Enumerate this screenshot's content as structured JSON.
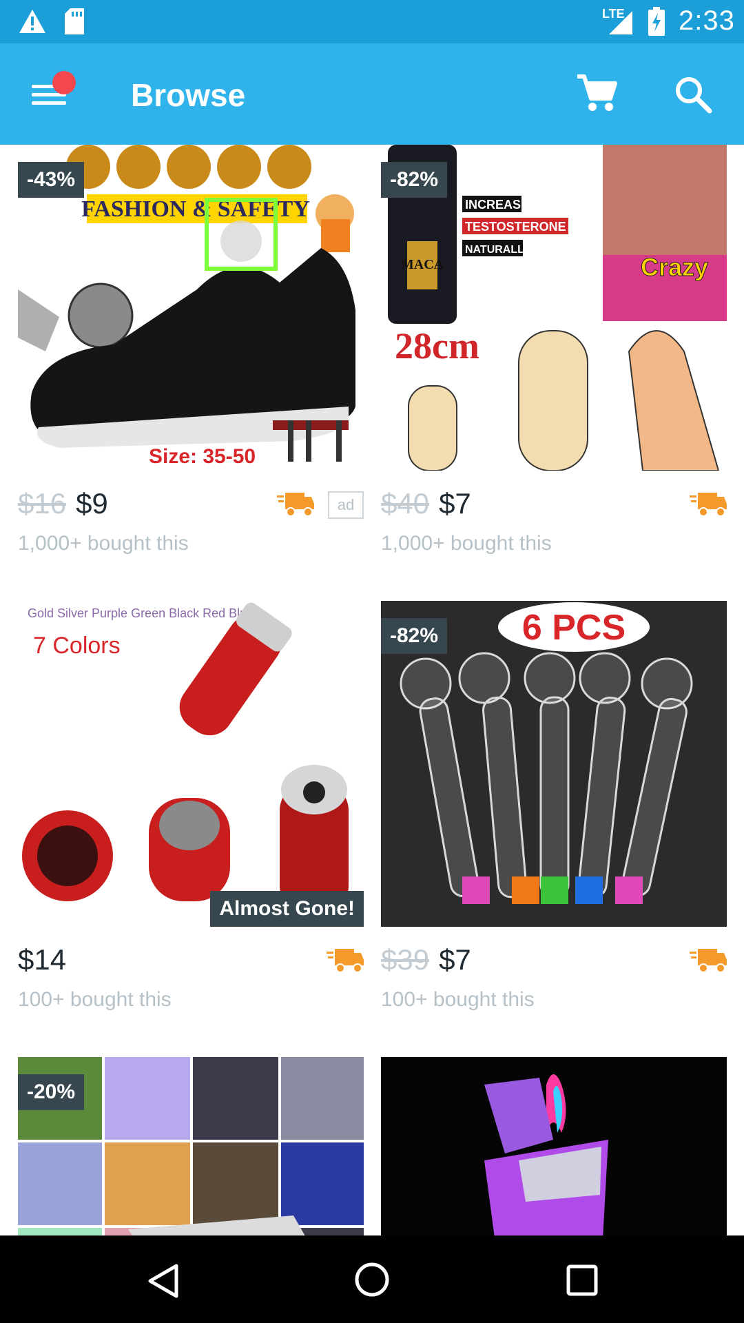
{
  "status_bar": {
    "network": "LTE",
    "time": "2:33",
    "icons": [
      "warning-icon",
      "sd-card-icon",
      "signal-icon",
      "battery-charging-icon"
    ]
  },
  "app_bar": {
    "title": "Browse",
    "icons": [
      "menu-icon",
      "cart-icon",
      "search-icon"
    ],
    "notification_dot_color": "#f2474d"
  },
  "products": [
    {
      "discount": "-43%",
      "image_text": [
        "FASHION & SAFETY",
        "Size: 35-50"
      ],
      "old_price": "$16",
      "price": "$9",
      "shipping_icon": "truck-icon",
      "ad_label": "ad",
      "bought": "1,000+ bought this"
    },
    {
      "discount": "-82%",
      "image_text": [
        "INCREASE",
        "TESTOSTERONE",
        "NATURALLY",
        "MACA",
        "Crazy",
        "28cm"
      ],
      "old_price": "$40",
      "price": "$7",
      "shipping_icon": "truck-icon",
      "bought": "1,000+ bought this"
    },
    {
      "image_text": [
        "Gold Silver Purple Green Black Red Blue",
        "7 Colors"
      ],
      "status_label": "Almost Gone!",
      "price": "$14",
      "shipping_icon": "truck-icon",
      "bought": "100+ bought this"
    },
    {
      "discount": "-82%",
      "image_text": [
        "6 PCS"
      ],
      "old_price": "$39",
      "price": "$7",
      "shipping_icon": "truck-icon",
      "bought": "100+ bought this"
    },
    {
      "discount": "-20%"
    },
    {}
  ],
  "colors": {
    "status_bar": "#1c9fd9",
    "app_bar": "#2fb3ea",
    "truck": "#f39a2b",
    "badge": "#37474f"
  }
}
